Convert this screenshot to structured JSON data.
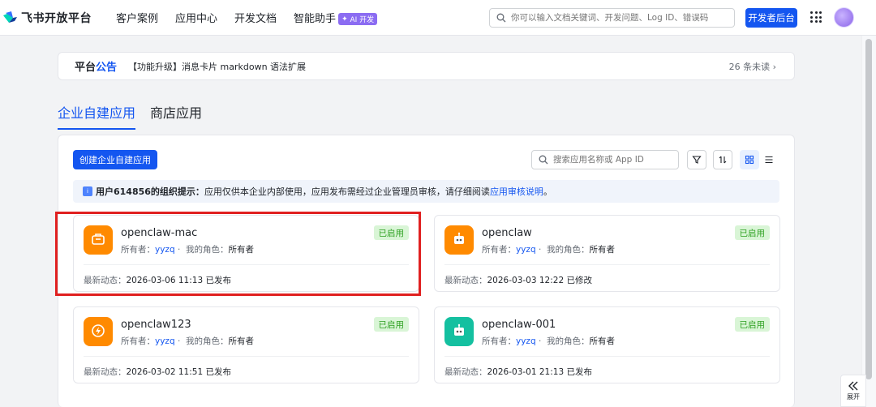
{
  "brand": {
    "name": "飞书开放平台"
  },
  "nav": {
    "links": [
      "客户案例",
      "应用中心",
      "开发文档"
    ],
    "assistant_label": "智能助手",
    "assistant_badge": "AI 开发"
  },
  "search": {
    "placeholder": "你可以输入文档关键词、开发问题、Log ID、错误码"
  },
  "header": {
    "dev_console_label": "开发者后台"
  },
  "announcement": {
    "title_part1": "平台",
    "title_part2": "公告",
    "text": "【功能升级】消息卡片 markdown 语法扩展",
    "unread": "26 条未读"
  },
  "tabs": [
    {
      "label": "企业自建应用",
      "active": true
    },
    {
      "label": "商店应用",
      "active": false
    }
  ],
  "panel": {
    "create_label": "创建企业自建应用",
    "search_placeholder": "搜索应用名称或 App ID",
    "notice_bold": "用户614856的组织提示：",
    "notice_text": "应用仅供本企业内部使用，应用发布需经过企业管理员审核，请仔细阅读 ",
    "notice_link": "应用审核说明",
    "notice_end": "。"
  },
  "apps": [
    {
      "name": "openclaw-mac",
      "status": "已启用",
      "owner_label": "所有者：",
      "owner": "yyzq",
      "role_label": "我的角色：",
      "role": "所有者",
      "activity_label": "最新动态：",
      "activity": "2026-03-06 11:13 已发布",
      "icon": "briefcase-icon",
      "color": "#ff8a00"
    },
    {
      "name": "openclaw",
      "status": "已启用",
      "owner_label": "所有者：",
      "owner": "yyzq",
      "role_label": "我的角色：",
      "role": "所有者",
      "activity_label": "最新动态：",
      "activity": "2026-03-03 12:22 已修改",
      "icon": "robot-icon",
      "color": "#ff8a00"
    },
    {
      "name": "openclaw123",
      "status": "已启用",
      "owner_label": "所有者：",
      "owner": "yyzq",
      "role_label": "我的角色：",
      "role": "所有者",
      "activity_label": "最新动态：",
      "activity": "2026-03-02 11:51 已发布",
      "icon": "bolt-icon",
      "color": "#ff8a00"
    },
    {
      "name": "openclaw-001",
      "status": "已启用",
      "owner_label": "所有者：",
      "owner": "yyzq",
      "role_label": "我的角色：",
      "role": "所有者",
      "activity_label": "最新动态：",
      "activity": "2026-03-01 21:13 已发布",
      "icon": "robot-icon",
      "color": "#14c0a0"
    }
  ],
  "expand": {
    "label": "展开"
  },
  "colors": {
    "primary": "#1456f0",
    "highlight": "#e02020",
    "status_green": "#2ea121"
  }
}
